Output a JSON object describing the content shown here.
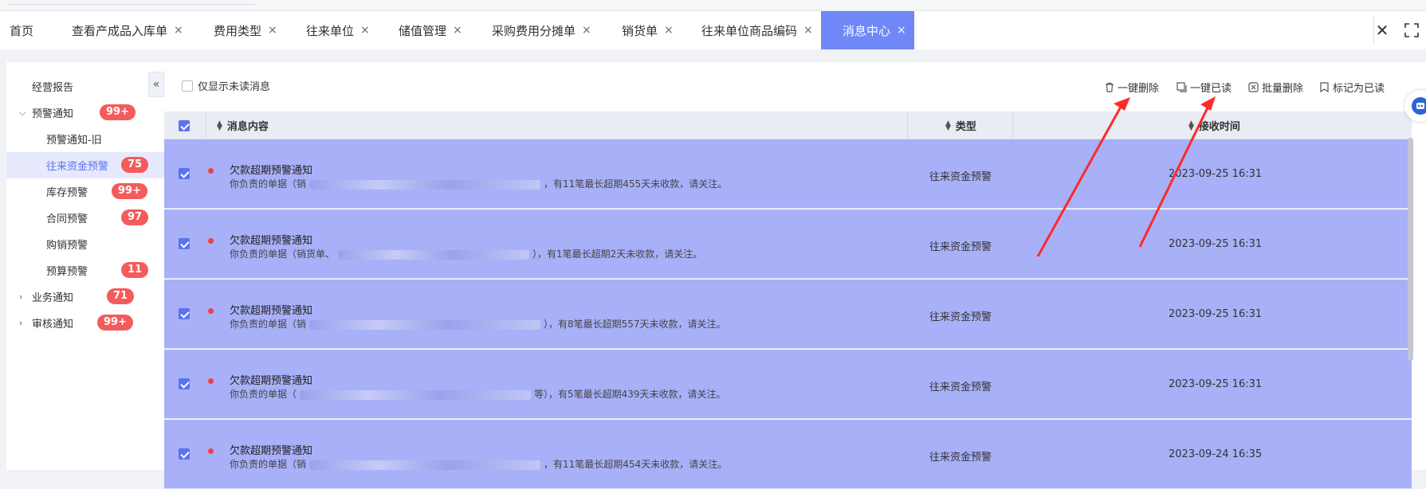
{
  "tabs": [
    {
      "label": "首页",
      "closable": false,
      "active": false
    },
    {
      "label": "查看产成品入库单",
      "closable": true,
      "active": false
    },
    {
      "label": "费用类型",
      "closable": true,
      "active": false
    },
    {
      "label": "往来单位",
      "closable": true,
      "active": false
    },
    {
      "label": "储值管理",
      "closable": true,
      "active": false
    },
    {
      "label": "采购费用分摊单",
      "closable": true,
      "active": false
    },
    {
      "label": "销货单",
      "closable": true,
      "active": false
    },
    {
      "label": "往来单位商品编码",
      "closable": true,
      "active": false
    },
    {
      "label": "消息中心",
      "closable": true,
      "active": true
    }
  ],
  "tab_close_glyph": "×",
  "tabbar_close_glyph": "✕",
  "sidebar": {
    "collapse_glyph": "«",
    "items": [
      {
        "label": "经营报告",
        "badge": "",
        "chevron": ""
      },
      {
        "label": "预警通知",
        "badge": "99+",
        "chevron": "⌵"
      },
      {
        "label": "预警通知-旧",
        "badge": "",
        "chevron": ""
      },
      {
        "label": "往来资金预警",
        "badge": "75",
        "chevron": ""
      },
      {
        "label": "库存预警",
        "badge": "99+",
        "chevron": ""
      },
      {
        "label": "合同预警",
        "badge": "97",
        "chevron": ""
      },
      {
        "label": "购销预警",
        "badge": "",
        "chevron": ""
      },
      {
        "label": "预算预警",
        "badge": "11",
        "chevron": ""
      },
      {
        "label": "业务通知",
        "badge": "71",
        "chevron": "›"
      },
      {
        "label": "审核通知",
        "badge": "99+",
        "chevron": "›"
      }
    ]
  },
  "toolbar": {
    "only_unread_label": "仅显示未读消息",
    "delete_all_label": "一键删除",
    "read_all_label": "一键已读",
    "batch_delete_label": "批量删除",
    "mark_read_label": "标记为已读"
  },
  "table": {
    "columns": {
      "content": "消息内容",
      "type": "类型",
      "time": "接收时间"
    },
    "rows": [
      {
        "title": "欠款超期预警通知",
        "detail_prefix": "你负责的单据（销",
        "detail_suffix": "，有11笔最长超期455天未收款，请关注。",
        "type": "往来资金预警",
        "time": "2023-09-25 16:31"
      },
      {
        "title": "欠款超期预警通知",
        "detail_prefix": "你负责的单据（销货单、",
        "detail_suffix": "），有1笔最长超期2天未收款，请关注。",
        "type": "往来资金预警",
        "time": "2023-09-25 16:31"
      },
      {
        "title": "欠款超期预警通知",
        "detail_prefix": "你负责的单据（销",
        "detail_suffix": "），有8笔最长超期557天未收款，请关注。",
        "type": "往来资金预警",
        "time": "2023-09-25 16:31"
      },
      {
        "title": "欠款超期预警通知",
        "detail_prefix": "你负责的单据（",
        "detail_suffix": "等），有5笔最长超期439天未收款，请关注。",
        "type": "往来资金预警",
        "time": "2023-09-25 16:31"
      },
      {
        "title": "欠款超期预警通知",
        "detail_prefix": "你负责的单据（销",
        "detail_suffix": "，有11笔最长超期454天未收款，请关注。",
        "type": "往来资金预警",
        "time": "2023-09-24 16:35"
      }
    ]
  },
  "colors": {
    "accent": "#6f87f7",
    "row_selected": "#a8b0f8",
    "badge": "#f45b5b",
    "annotation_arrow": "#ff2a2a"
  }
}
